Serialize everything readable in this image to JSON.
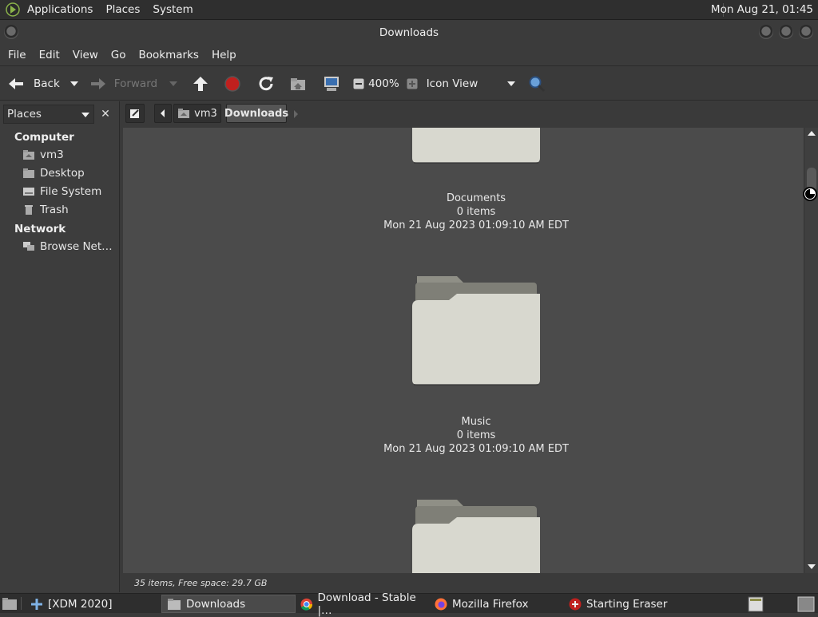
{
  "top_panel": {
    "menus": [
      "Applications",
      "Places",
      "System"
    ],
    "clock": "Mon Aug 21, 01:45"
  },
  "window": {
    "title": "Downloads"
  },
  "menubar": [
    "File",
    "Edit",
    "View",
    "Go",
    "Bookmarks",
    "Help"
  ],
  "toolbar": {
    "back_label": "Back",
    "forward_label": "Forward",
    "zoom": "400%",
    "view_mode": "Icon View"
  },
  "sidebar": {
    "header": "Places",
    "sections": [
      {
        "title": "Computer",
        "items": [
          "vm3",
          "Desktop",
          "File System",
          "Trash"
        ]
      },
      {
        "title": "Network",
        "items": [
          "Browse Net…"
        ]
      }
    ]
  },
  "pathbar": {
    "crumbs": [
      "vm3",
      "Downloads"
    ]
  },
  "files": [
    {
      "name": "Documents",
      "info": "0 items",
      "date": "Mon 21 Aug 2023 01:09:10 AM EDT"
    },
    {
      "name": "Music",
      "info": "0 items",
      "date": "Mon 21 Aug 2023 01:09:10 AM EDT"
    }
  ],
  "status": "35 items, Free space: 29.7 GB",
  "taskbar": {
    "tasks": [
      "[XDM 2020]",
      "Downloads",
      "Download - Stable |…",
      "Mozilla Firefox",
      "Starting Eraser"
    ]
  },
  "colors": {
    "panel": "#2f2f2f",
    "window": "#3a3a3a",
    "content": "#4b4b4b",
    "folder": "#d8d8cf",
    "stop": "#c0201e"
  }
}
